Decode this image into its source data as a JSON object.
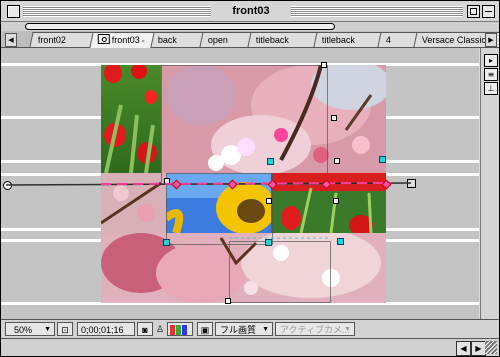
{
  "window": {
    "title": "front03"
  },
  "tabs": [
    {
      "label": "front02",
      "active": false,
      "has_icon": false
    },
    {
      "label": "front03",
      "active": true,
      "has_icon": true
    },
    {
      "label": "back",
      "active": false,
      "has_icon": false
    },
    {
      "label": "open",
      "active": false,
      "has_icon": false
    },
    {
      "label": "titleback",
      "active": false,
      "has_icon": false
    },
    {
      "label": "titleback",
      "active": false,
      "has_icon": false
    },
    {
      "label": "4",
      "active": false,
      "has_icon": false
    },
    {
      "label": "Versace Classic wi",
      "active": false,
      "has_icon": false
    }
  ],
  "bottombar": {
    "zoom": "50%",
    "timecode": "0;00;01;16",
    "resolution": "フル画質",
    "camera": "アクティブカメ..."
  },
  "colors": {
    "background": "#c4c4c4",
    "handle_cyan": "#1bd7d7",
    "motion_path": "#ff3c9c"
  },
  "icons": [
    "close-box-icon",
    "zoom-box-icon",
    "collapse-box-icon",
    "camera-icon",
    "tab-menu-icon",
    "region-of-interest-icon",
    "snapshot-icon",
    "channel-icon",
    "flowchart-icon",
    "comp-menu-icon",
    "arrow-left-icon",
    "arrow-right-icon",
    "grow-box-icon"
  ]
}
